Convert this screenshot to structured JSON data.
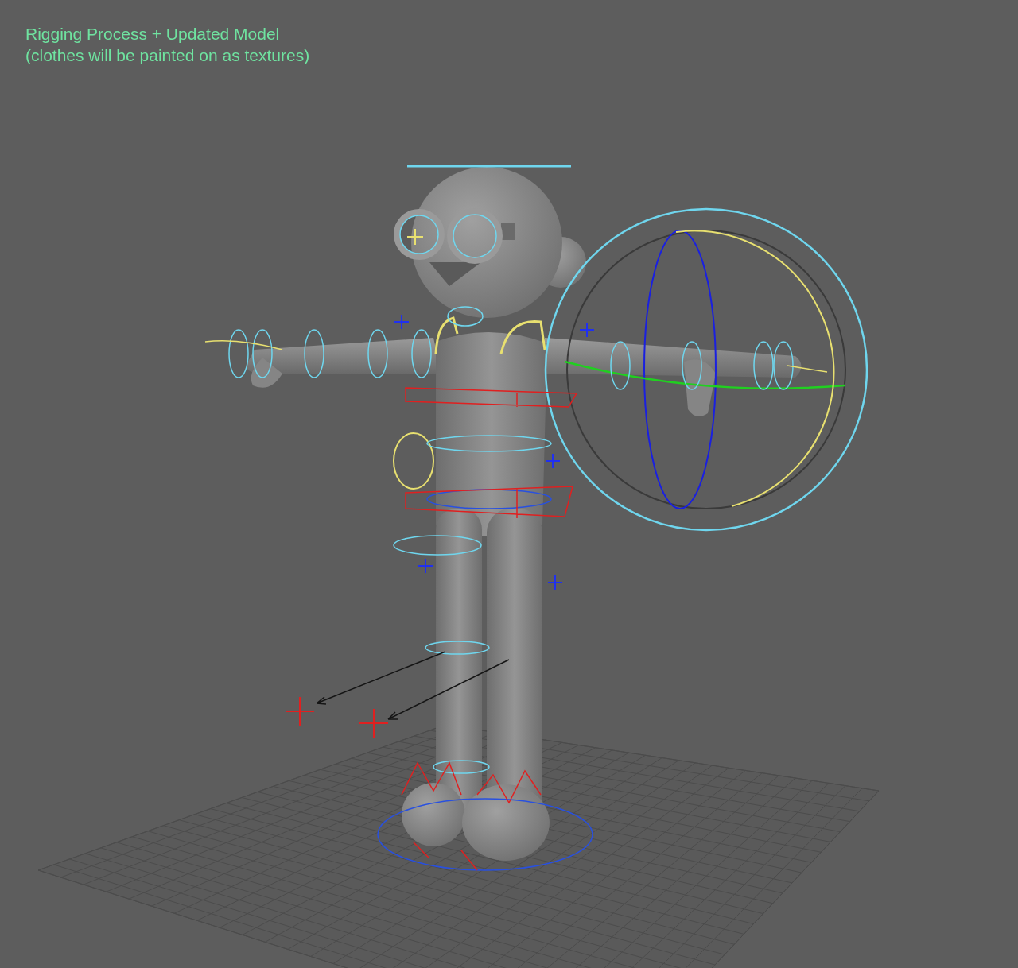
{
  "viewport": {
    "caption": [
      "Rigging Process + Updated Model",
      "(clothes will be painted on as textures)"
    ]
  }
}
